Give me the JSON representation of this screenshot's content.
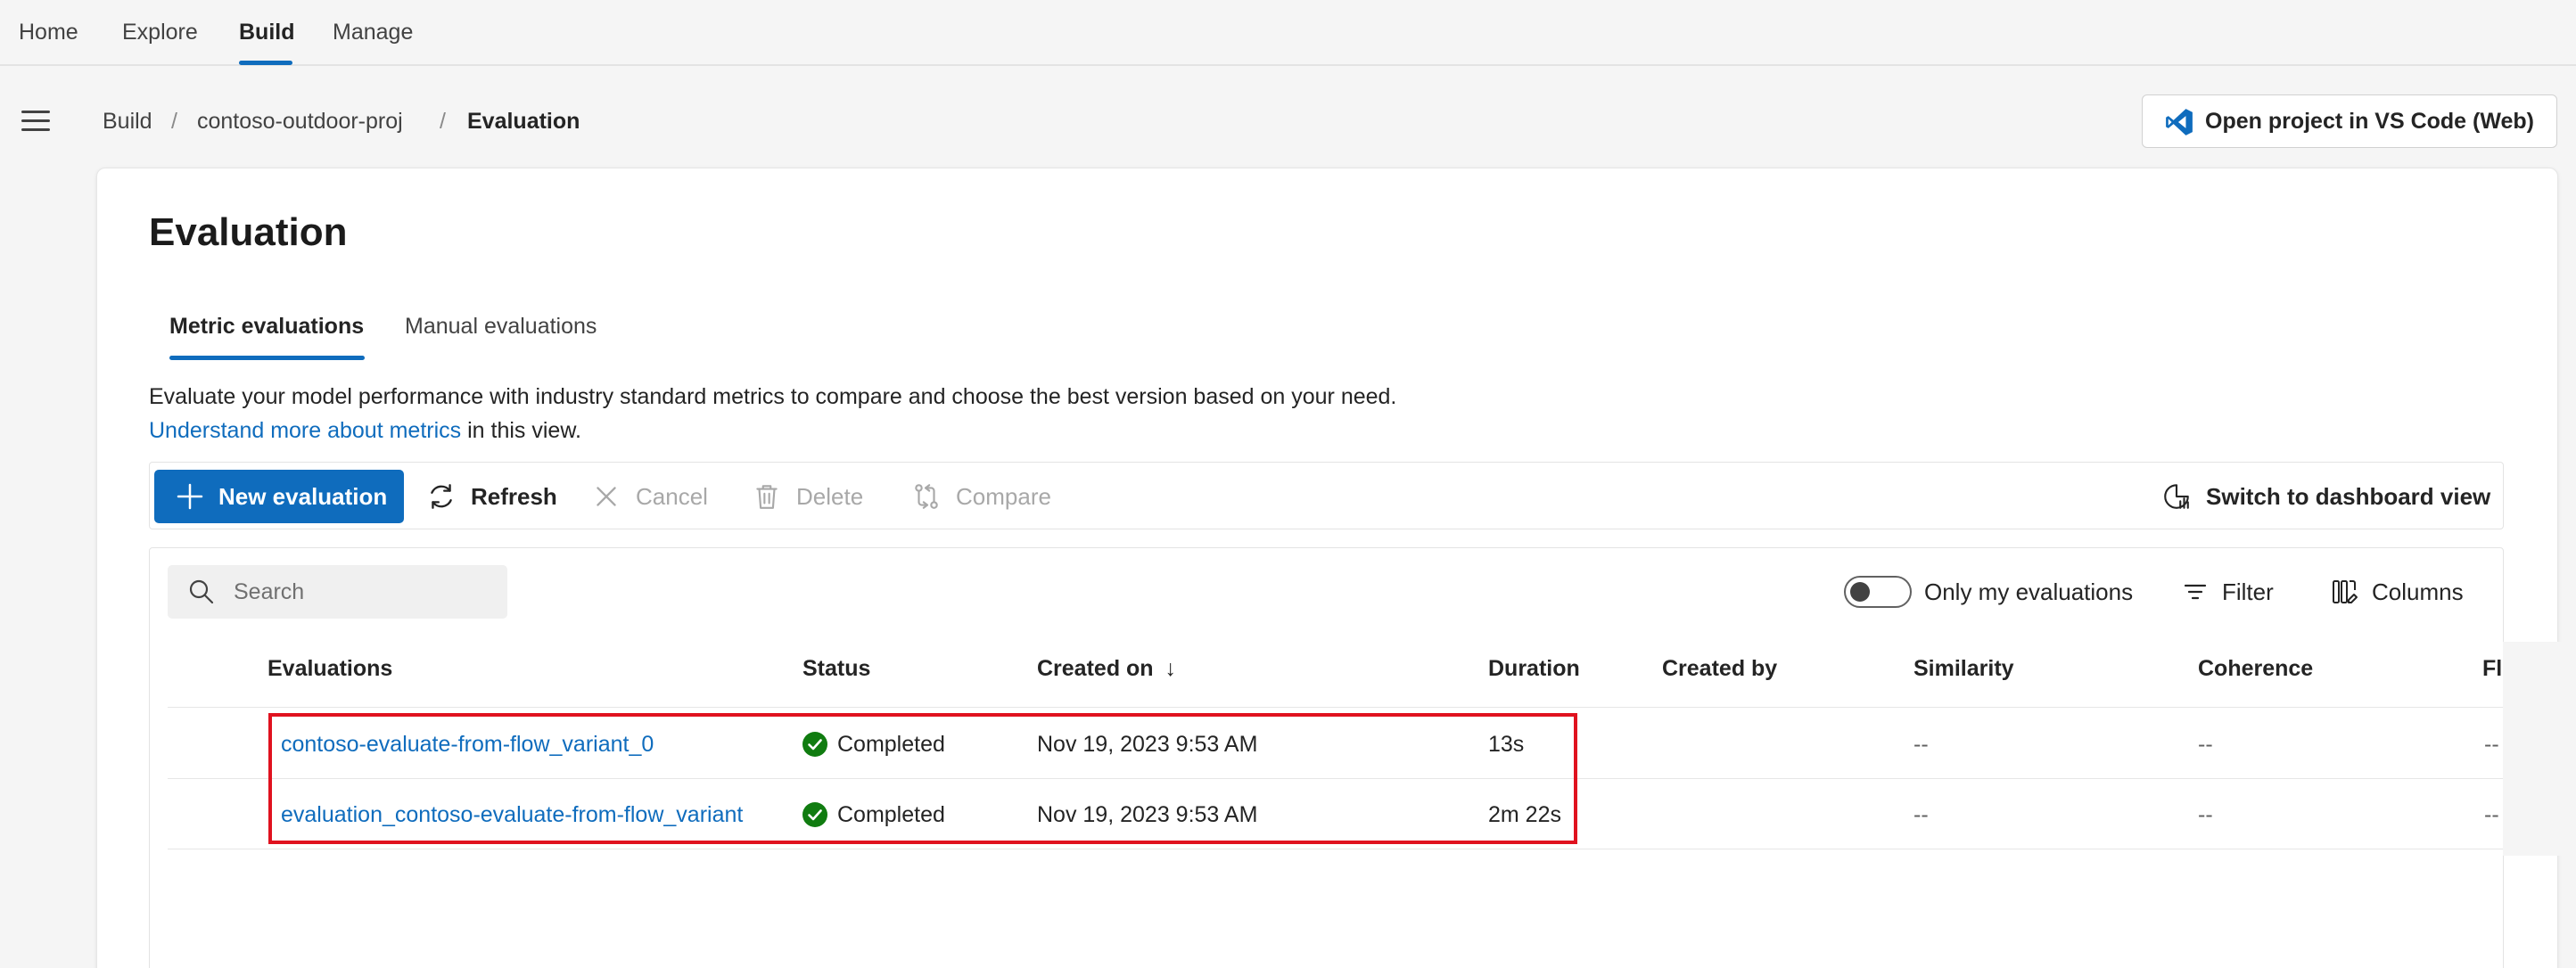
{
  "topnav": {
    "items": [
      {
        "label": "Home",
        "active": false
      },
      {
        "label": "Explore",
        "active": false
      },
      {
        "label": "Build",
        "active": true
      },
      {
        "label": "Manage",
        "active": false
      }
    ]
  },
  "breadcrumb": {
    "items": [
      "Build",
      "contoso-outdoor-proj",
      "Evaluation"
    ],
    "separator": "/"
  },
  "header": {
    "vscode_button_label": "Open project in VS Code (Web)",
    "vscode_icon": "vscode-icon"
  },
  "page": {
    "title": "Evaluation",
    "tabs": [
      {
        "label": "Metric evaluations",
        "active": true
      },
      {
        "label": "Manual evaluations",
        "active": false
      }
    ],
    "description_before": "Evaluate your model performance with industry standard metrics to compare and choose the best version based on your need.",
    "description_link": "Understand more about metrics",
    "description_after": "in this view."
  },
  "toolbar": {
    "new_evaluation": "New evaluation",
    "refresh": "Refresh",
    "cancel": "Cancel",
    "delete": "Delete",
    "compare": "Compare",
    "switch_view": "Switch to dashboard view"
  },
  "grid": {
    "search_placeholder": "Search",
    "toggle_label": "Only my evaluations",
    "toggle_on": false,
    "filter_label": "Filter",
    "columns_label": "Columns",
    "headers": {
      "evaluations": "Evaluations",
      "status": "Status",
      "created_on": "Created on",
      "sort_indicator": "↓",
      "duration": "Duration",
      "created_by": "Created by",
      "similarity": "Similarity",
      "coherence": "Coherence",
      "fluency_truncated": "Flu"
    },
    "rows": [
      {
        "name": "contoso-evaluate-from-flow_variant_0",
        "status": "Completed",
        "created_on": "Nov 19, 2023 9:53 AM",
        "duration": "13s",
        "created_by": "",
        "similarity": "--",
        "coherence": "--",
        "fluency": "--"
      },
      {
        "name": "evaluation_contoso-evaluate-from-flow_variant",
        "status": "Completed",
        "created_on": "Nov 19, 2023 9:53 AM",
        "duration": "2m 22s",
        "created_by": "",
        "similarity": "--",
        "coherence": "--",
        "fluency": "--"
      }
    ]
  },
  "colors": {
    "accent": "#0f6cbd",
    "success": "#107c10",
    "highlight_box": "#e0121f"
  }
}
